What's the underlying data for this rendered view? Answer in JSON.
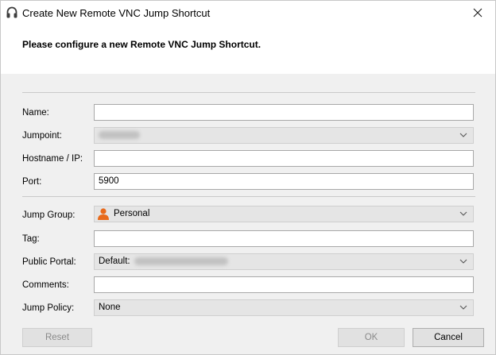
{
  "window": {
    "title": "Create New Remote VNC Jump Shortcut",
    "header": "Please configure a new Remote VNC Jump Shortcut."
  },
  "form": {
    "name_label": "Name:",
    "name_value": "",
    "jumpoint_label": "Jumpoint:",
    "hostname_label": "Hostname / IP:",
    "hostname_value": "",
    "port_label": "Port:",
    "port_value": "5900",
    "jump_group_label": "Jump Group:",
    "jump_group_value": "Personal",
    "tag_label": "Tag:",
    "tag_value": "",
    "public_portal_label": "Public Portal:",
    "public_portal_prefix": "Default:",
    "comments_label": "Comments:",
    "comments_value": "",
    "jump_policy_label": "Jump Policy:",
    "jump_policy_value": "None"
  },
  "buttons": {
    "reset": "Reset",
    "ok": "OK",
    "cancel": "Cancel"
  },
  "icons": {
    "title": "headset-icon",
    "close": "close-icon",
    "jump_group": "person-icon",
    "dropdown": "chevron-down-icon"
  }
}
